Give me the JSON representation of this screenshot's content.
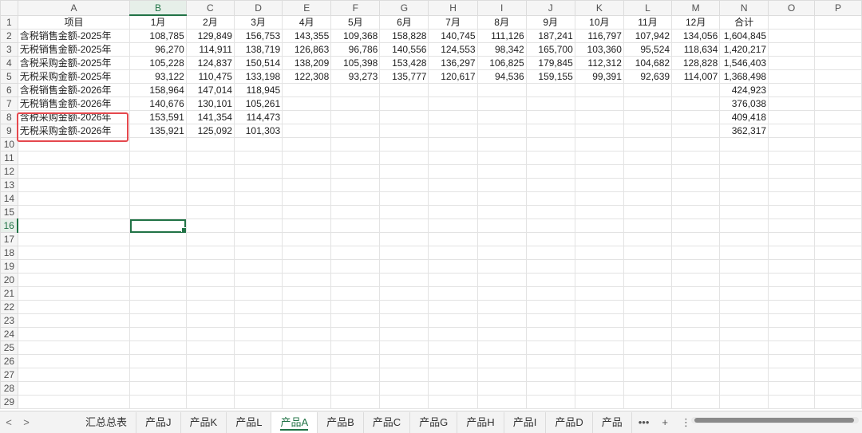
{
  "columns": [
    "A",
    "B",
    "C",
    "D",
    "E",
    "F",
    "G",
    "H",
    "I",
    "J",
    "K",
    "L",
    "M",
    "N",
    "O",
    "P"
  ],
  "active_column": "B",
  "active_row": "16",
  "header_row": [
    "项目",
    "1月",
    "2月",
    "3月",
    "4月",
    "5月",
    "6月",
    "7月",
    "8月",
    "9月",
    "10月",
    "11月",
    "12月",
    "合计",
    "",
    ""
  ],
  "data_rows": [
    [
      "含税销售金额-2025年",
      "108,785",
      "129,849",
      "156,753",
      "143,355",
      "109,368",
      "158,828",
      "140,745",
      "111,126",
      "187,241",
      "116,797",
      "107,942",
      "134,056",
      "1,604,845",
      "",
      ""
    ],
    [
      "无税销售金额-2025年",
      "96,270",
      "114,911",
      "138,719",
      "126,863",
      "96,786",
      "140,556",
      "124,553",
      "98,342",
      "165,700",
      "103,360",
      "95,524",
      "118,634",
      "1,420,217",
      "",
      ""
    ],
    [
      "含税采购金额-2025年",
      "105,228",
      "124,837",
      "150,514",
      "138,209",
      "105,398",
      "153,428",
      "136,297",
      "106,825",
      "179,845",
      "112,312",
      "104,682",
      "128,828",
      "1,546,403",
      "",
      ""
    ],
    [
      "无税采购金额-2025年",
      "93,122",
      "110,475",
      "133,198",
      "122,308",
      "93,273",
      "135,777",
      "120,617",
      "94,536",
      "159,155",
      "99,391",
      "92,639",
      "114,007",
      "1,368,498",
      "",
      ""
    ],
    [
      "含税销售金额-2026年",
      "158,964",
      "147,014",
      "118,945",
      "",
      "",
      "",
      "",
      "",
      "",
      "",
      "",
      "",
      "424,923",
      "",
      ""
    ],
    [
      "无税销售金额-2026年",
      "140,676",
      "130,101",
      "105,261",
      "",
      "",
      "",
      "",
      "",
      "",
      "",
      "",
      "",
      "376,038",
      "",
      ""
    ],
    [
      "含税采购金额-2026年",
      "153,591",
      "141,354",
      "114,473",
      "",
      "",
      "",
      "",
      "",
      "",
      "",
      "",
      "",
      "409,418",
      "",
      ""
    ],
    [
      "无税采购金额-2026年",
      "135,921",
      "125,092",
      "101,303",
      "",
      "",
      "",
      "",
      "",
      "",
      "",
      "",
      "",
      "362,317",
      "",
      ""
    ]
  ],
  "row_numbers": [
    "1",
    "2",
    "3",
    "4",
    "5",
    "6",
    "7",
    "8",
    "9",
    "10",
    "11",
    "12",
    "13",
    "14",
    "15",
    "16",
    "17",
    "18",
    "19",
    "20",
    "21",
    "22",
    "23",
    "24",
    "25",
    "26",
    "27",
    "28",
    "29"
  ],
  "sheet_tabs": [
    "汇总总表",
    "产品J",
    "产品K",
    "产品L",
    "产品A",
    "产品B",
    "产品C",
    "产品G",
    "产品H",
    "产品I",
    "产品D",
    "产品"
  ],
  "active_tab": "产品A",
  "tabbar": {
    "prev_arrow": "<",
    "next_arrow": ">",
    "more": "•••",
    "add": "+",
    "menu": "⋮"
  },
  "colors": {
    "accent": "#217346",
    "highlight_box": "#e5484d"
  }
}
